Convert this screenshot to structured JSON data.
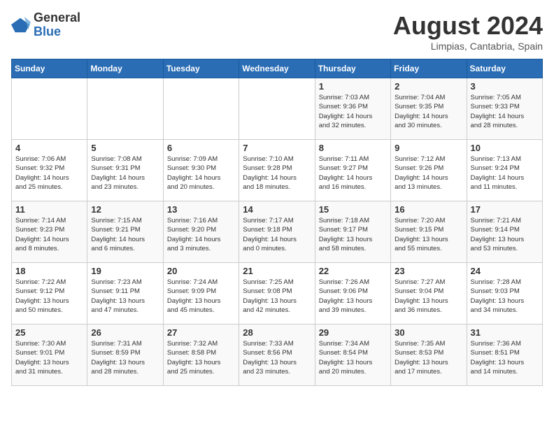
{
  "logo": {
    "general": "General",
    "blue": "Blue"
  },
  "title": {
    "month_year": "August 2024",
    "location": "Limpias, Cantabria, Spain"
  },
  "days_of_week": [
    "Sunday",
    "Monday",
    "Tuesday",
    "Wednesday",
    "Thursday",
    "Friday",
    "Saturday"
  ],
  "weeks": [
    [
      {
        "day": "",
        "info": ""
      },
      {
        "day": "",
        "info": ""
      },
      {
        "day": "",
        "info": ""
      },
      {
        "day": "",
        "info": ""
      },
      {
        "day": "1",
        "info": "Sunrise: 7:03 AM\nSunset: 9:36 PM\nDaylight: 14 hours\nand 32 minutes."
      },
      {
        "day": "2",
        "info": "Sunrise: 7:04 AM\nSunset: 9:35 PM\nDaylight: 14 hours\nand 30 minutes."
      },
      {
        "day": "3",
        "info": "Sunrise: 7:05 AM\nSunset: 9:33 PM\nDaylight: 14 hours\nand 28 minutes."
      }
    ],
    [
      {
        "day": "4",
        "info": "Sunrise: 7:06 AM\nSunset: 9:32 PM\nDaylight: 14 hours\nand 25 minutes."
      },
      {
        "day": "5",
        "info": "Sunrise: 7:08 AM\nSunset: 9:31 PM\nDaylight: 14 hours\nand 23 minutes."
      },
      {
        "day": "6",
        "info": "Sunrise: 7:09 AM\nSunset: 9:30 PM\nDaylight: 14 hours\nand 20 minutes."
      },
      {
        "day": "7",
        "info": "Sunrise: 7:10 AM\nSunset: 9:28 PM\nDaylight: 14 hours\nand 18 minutes."
      },
      {
        "day": "8",
        "info": "Sunrise: 7:11 AM\nSunset: 9:27 PM\nDaylight: 14 hours\nand 16 minutes."
      },
      {
        "day": "9",
        "info": "Sunrise: 7:12 AM\nSunset: 9:26 PM\nDaylight: 14 hours\nand 13 minutes."
      },
      {
        "day": "10",
        "info": "Sunrise: 7:13 AM\nSunset: 9:24 PM\nDaylight: 14 hours\nand 11 minutes."
      }
    ],
    [
      {
        "day": "11",
        "info": "Sunrise: 7:14 AM\nSunset: 9:23 PM\nDaylight: 14 hours\nand 8 minutes."
      },
      {
        "day": "12",
        "info": "Sunrise: 7:15 AM\nSunset: 9:21 PM\nDaylight: 14 hours\nand 6 minutes."
      },
      {
        "day": "13",
        "info": "Sunrise: 7:16 AM\nSunset: 9:20 PM\nDaylight: 14 hours\nand 3 minutes."
      },
      {
        "day": "14",
        "info": "Sunrise: 7:17 AM\nSunset: 9:18 PM\nDaylight: 14 hours\nand 0 minutes."
      },
      {
        "day": "15",
        "info": "Sunrise: 7:18 AM\nSunset: 9:17 PM\nDaylight: 13 hours\nand 58 minutes."
      },
      {
        "day": "16",
        "info": "Sunrise: 7:20 AM\nSunset: 9:15 PM\nDaylight: 13 hours\nand 55 minutes."
      },
      {
        "day": "17",
        "info": "Sunrise: 7:21 AM\nSunset: 9:14 PM\nDaylight: 13 hours\nand 53 minutes."
      }
    ],
    [
      {
        "day": "18",
        "info": "Sunrise: 7:22 AM\nSunset: 9:12 PM\nDaylight: 13 hours\nand 50 minutes."
      },
      {
        "day": "19",
        "info": "Sunrise: 7:23 AM\nSunset: 9:11 PM\nDaylight: 13 hours\nand 47 minutes."
      },
      {
        "day": "20",
        "info": "Sunrise: 7:24 AM\nSunset: 9:09 PM\nDaylight: 13 hours\nand 45 minutes."
      },
      {
        "day": "21",
        "info": "Sunrise: 7:25 AM\nSunset: 9:08 PM\nDaylight: 13 hours\nand 42 minutes."
      },
      {
        "day": "22",
        "info": "Sunrise: 7:26 AM\nSunset: 9:06 PM\nDaylight: 13 hours\nand 39 minutes."
      },
      {
        "day": "23",
        "info": "Sunrise: 7:27 AM\nSunset: 9:04 PM\nDaylight: 13 hours\nand 36 minutes."
      },
      {
        "day": "24",
        "info": "Sunrise: 7:28 AM\nSunset: 9:03 PM\nDaylight: 13 hours\nand 34 minutes."
      }
    ],
    [
      {
        "day": "25",
        "info": "Sunrise: 7:30 AM\nSunset: 9:01 PM\nDaylight: 13 hours\nand 31 minutes."
      },
      {
        "day": "26",
        "info": "Sunrise: 7:31 AM\nSunset: 8:59 PM\nDaylight: 13 hours\nand 28 minutes."
      },
      {
        "day": "27",
        "info": "Sunrise: 7:32 AM\nSunset: 8:58 PM\nDaylight: 13 hours\nand 25 minutes."
      },
      {
        "day": "28",
        "info": "Sunrise: 7:33 AM\nSunset: 8:56 PM\nDaylight: 13 hours\nand 23 minutes."
      },
      {
        "day": "29",
        "info": "Sunrise: 7:34 AM\nSunset: 8:54 PM\nDaylight: 13 hours\nand 20 minutes."
      },
      {
        "day": "30",
        "info": "Sunrise: 7:35 AM\nSunset: 8:53 PM\nDaylight: 13 hours\nand 17 minutes."
      },
      {
        "day": "31",
        "info": "Sunrise: 7:36 AM\nSunset: 8:51 PM\nDaylight: 13 hours\nand 14 minutes."
      }
    ]
  ]
}
